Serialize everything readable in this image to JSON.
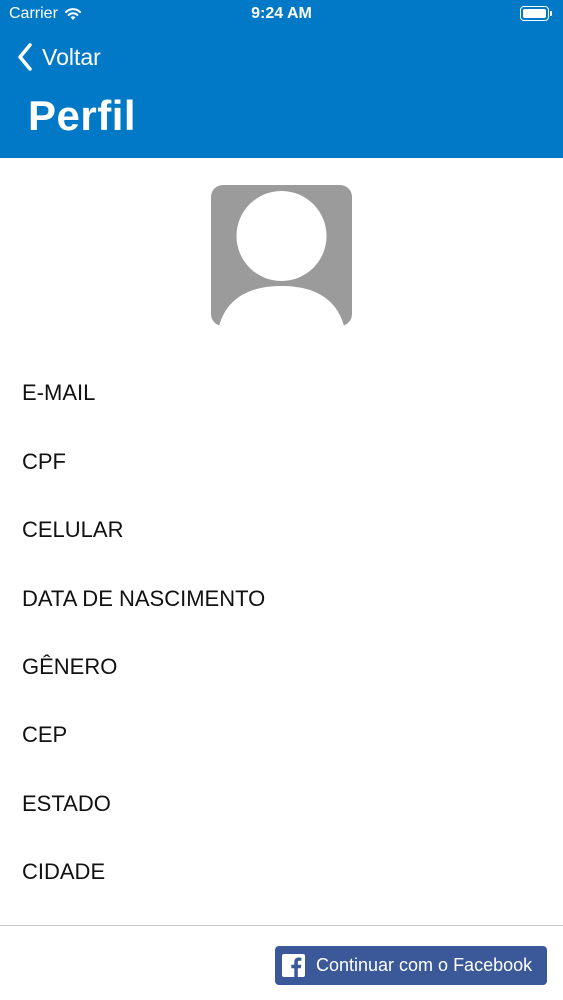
{
  "status_bar": {
    "carrier": "Carrier",
    "time": "9:24 AM",
    "wifi_icon": "wifi-icon",
    "battery_icon": "battery-icon"
  },
  "nav": {
    "back_label": "Voltar",
    "back_icon": "chevron-left-icon",
    "title": "Perfil"
  },
  "avatar": {
    "icon": "person-placeholder-icon"
  },
  "fields": [
    {
      "label": "E-MAIL"
    },
    {
      "label": "CPF"
    },
    {
      "label": "CELULAR"
    },
    {
      "label": "DATA DE NASCIMENTO"
    },
    {
      "label": "GÊNERO"
    },
    {
      "label": "CEP"
    },
    {
      "label": "ESTADO"
    },
    {
      "label": "CIDADE"
    }
  ],
  "facebook_button": {
    "label": "Continuar com o Facebook",
    "icon": "facebook-icon"
  },
  "colors": {
    "header_background": "#0179c6",
    "facebook_blue": "#3b5998",
    "avatar_gray": "#9b9b9b"
  }
}
